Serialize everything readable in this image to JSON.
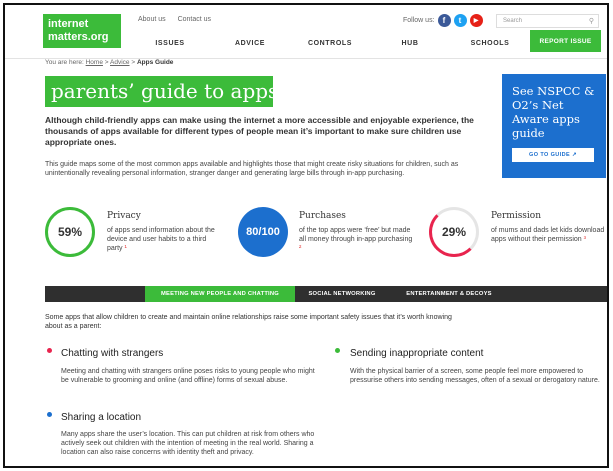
{
  "header": {
    "logo_line1": "internet",
    "logo_line2": "matters.org",
    "top_links": [
      "About us",
      "Contact us"
    ],
    "follow_label": "Follow us:",
    "social_icons": [
      {
        "name": "facebook-icon",
        "glyph": "f",
        "color": "#3b5998"
      },
      {
        "name": "twitter-icon",
        "glyph": "t",
        "color": "#1da1f2"
      },
      {
        "name": "youtube-icon",
        "glyph": "▶",
        "color": "#e62117"
      }
    ],
    "search_placeholder": "Search",
    "nav": [
      "ISSUES",
      "ADVICE",
      "CONTROLS",
      "HUB",
      "SCHOOLS"
    ],
    "report_label": "REPORT ISSUE"
  },
  "breadcrumb": {
    "prefix": "You are here:",
    "items": [
      "Home",
      "Advice"
    ],
    "current": "Apps Guide",
    "sep": ">"
  },
  "page": {
    "title": "parents’ guide to apps",
    "intro": "Although child-friendly apps can make using the internet a more accessible and enjoyable experience, the thousands of apps available for different types of people mean it’s important to make sure children use appropriate ones.",
    "sub": "This guide maps some of the most common apps available and highlights those that might create risky situations for children, such as unintentionally revealing personal information, stranger danger and generating large bills through in-app purchasing."
  },
  "nspcc": {
    "text": "See NSPCC & O2’s Net Aware apps guide",
    "button": "GO TO GUIDE ↗"
  },
  "stats": [
    {
      "value": "59%",
      "label": "Privacy",
      "desc": "of apps send information about the device and user habits to a third party",
      "mark": "¹"
    },
    {
      "value": "80/100",
      "label": "Purchases",
      "desc": "of the top apps were ‘free’ but made all money through in-app purchasing",
      "mark": "²"
    },
    {
      "value": "29%",
      "label": "Permission",
      "desc": "of mums and dads let kids download apps without their permission",
      "mark": "³"
    }
  ],
  "tabs": [
    "MEETING NEW PEOPLE AND CHATTING",
    "SOCIAL NETWORKING",
    "ENTERTAINMENT & DECOYS"
  ],
  "section": {
    "lead": "Some apps that allow children to create and maintain online relationships raise some important safety issues that it’s worth knowing about as a parent:",
    "items": [
      {
        "title": "Chatting with strangers",
        "text": "Meeting and chatting with strangers online poses risks to young people who might be vulnerable to grooming and online (and offline) forms of sexual abuse.",
        "color": "#e8244e"
      },
      {
        "title": "Sending inappropriate content",
        "text": "With the physical barrier of a screen, some people feel more empowered to pressurise others into sending messages, often of a sexual or derogatory nature.",
        "color": "#3cbb3a"
      },
      {
        "title": "Sharing a location",
        "text": "Many apps share the user’s location. This can put children at risk from others who actively seek out children with the intention of meeting in the real world. Sharing a location can also raise concerns with identity theft and privacy.",
        "color": "#1c6fce"
      }
    ]
  },
  "colors": {
    "green": "#3cbb3a",
    "blue": "#1c6fce",
    "dark": "#2f2f2f",
    "pink": "#e8244e"
  }
}
